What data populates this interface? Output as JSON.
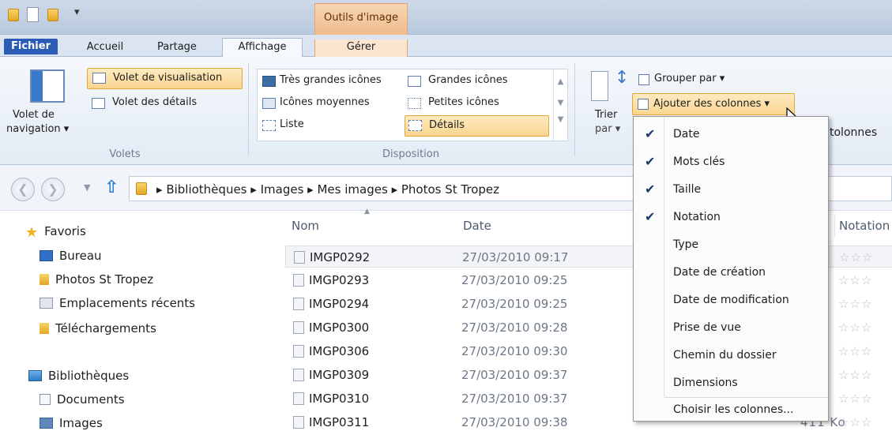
{
  "titlebar": {
    "context_tab": "Outils d'image"
  },
  "tabs": [
    {
      "label": "Fichier"
    },
    {
      "label": "Accueil"
    },
    {
      "label": "Partage"
    },
    {
      "label": "Affichage"
    },
    {
      "label": "Gérer"
    }
  ],
  "ribbon": {
    "panes_group": {
      "label": "Volets",
      "nav_pane_line1": "Volet de",
      "nav_pane_line2": "navigation ▾",
      "preview_pane": "Volet de visualisation",
      "details_pane": "Volet des détails"
    },
    "layout_group": {
      "label": "Disposition",
      "items": [
        "Très grandes icônes",
        "Grandes icônes",
        "Icônes moyennes",
        "Petites icônes",
        "Liste",
        "Détails"
      ]
    },
    "sort_by_line1": "Trier",
    "sort_by_line2": "par ▾",
    "group_by": "Grouper par ▾",
    "add_columns": "Ajouter des colonnes ▾",
    "partial_label": "tolonnes"
  },
  "address": {
    "segments": [
      "Bibliothèques",
      "Images",
      "Mes images",
      "Photos St Tropez"
    ]
  },
  "left_nav": {
    "favorites": "Favoris",
    "favorite_items": [
      "Bureau",
      "Photos St Tropez",
      "Emplacements récents",
      "Téléchargements"
    ],
    "libraries": "Bibliothèques",
    "library_items": [
      "Documents",
      "Images"
    ]
  },
  "columns": {
    "name": "Nom",
    "date": "Date",
    "rating": "Notation"
  },
  "files": [
    {
      "name": "IMGP0292",
      "date": "27/03/2010 09:17"
    },
    {
      "name": "IMGP0293",
      "date": "27/03/2010 09:25"
    },
    {
      "name": "IMGP0294",
      "date": "27/03/2010 09:25"
    },
    {
      "name": "IMGP0300",
      "date": "27/03/2010 09:28"
    },
    {
      "name": "IMGP0306",
      "date": "27/03/2010 09:30"
    },
    {
      "name": "IMGP0309",
      "date": "27/03/2010 09:37"
    },
    {
      "name": "IMGP0310",
      "date": "27/03/2010 09:37"
    },
    {
      "name": "IMGP0311",
      "date": "27/03/2010 09:38"
    }
  ],
  "last_row_size": "411 Ko",
  "stars": "☆☆☆",
  "menu": {
    "items": [
      {
        "label": "Date",
        "checked": "✔"
      },
      {
        "label": "Mots clés",
        "checked": "✔"
      },
      {
        "label": "Taille",
        "checked": "✔"
      },
      {
        "label": "Notation",
        "checked": "✔"
      },
      {
        "label": "Type",
        "checked": ""
      },
      {
        "label": "Date de création",
        "checked": ""
      },
      {
        "label": "Date de modification",
        "checked": ""
      },
      {
        "label": "Prise de vue",
        "checked": ""
      },
      {
        "label": "Chemin du dossier",
        "checked": ""
      },
      {
        "label": "Dimensions",
        "checked": ""
      }
    ],
    "choose": "Choisir les colonnes..."
  },
  "colors": {
    "accent": "#2a5bb5",
    "highlight": "#f9d58f",
    "context": "#f1bb8c"
  }
}
